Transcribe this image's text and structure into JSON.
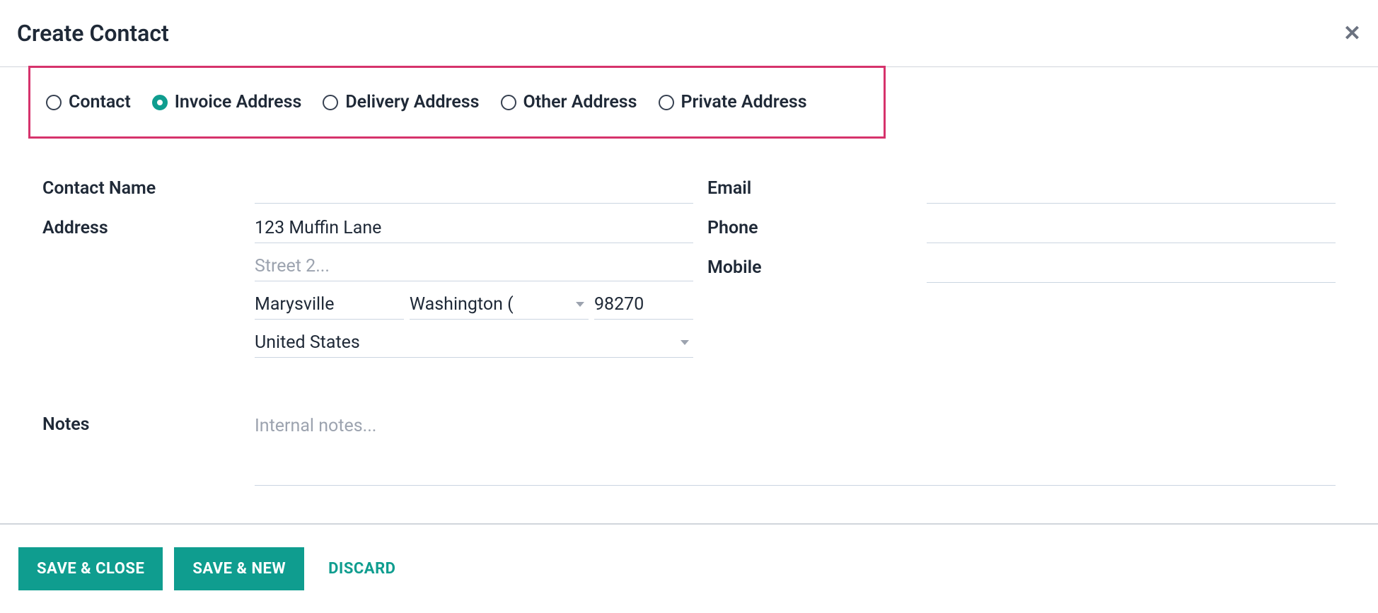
{
  "header": {
    "title": "Create Contact"
  },
  "contact_type": {
    "options": [
      {
        "id": "contact",
        "label": "Contact",
        "selected": false
      },
      {
        "id": "invoice",
        "label": "Invoice Address",
        "selected": true
      },
      {
        "id": "delivery",
        "label": "Delivery Address",
        "selected": false
      },
      {
        "id": "other",
        "label": "Other Address",
        "selected": false
      },
      {
        "id": "private",
        "label": "Private Address",
        "selected": false
      }
    ]
  },
  "fields": {
    "contact_name": {
      "label": "Contact Name",
      "value": ""
    },
    "address": {
      "label": "Address",
      "street1": "123 Muffin Lane",
      "street2": "",
      "street2_placeholder": "Street 2...",
      "city": "Marysville",
      "state": "Washington (",
      "zip": "98270",
      "country": "United States"
    },
    "email": {
      "label": "Email",
      "value": ""
    },
    "phone": {
      "label": "Phone",
      "value": ""
    },
    "mobile": {
      "label": "Mobile",
      "value": ""
    },
    "notes": {
      "label": "Notes",
      "value": "",
      "placeholder": "Internal notes..."
    }
  },
  "buttons": {
    "save_close": "SAVE & CLOSE",
    "save_new": "SAVE & NEW",
    "discard": "DISCARD"
  }
}
